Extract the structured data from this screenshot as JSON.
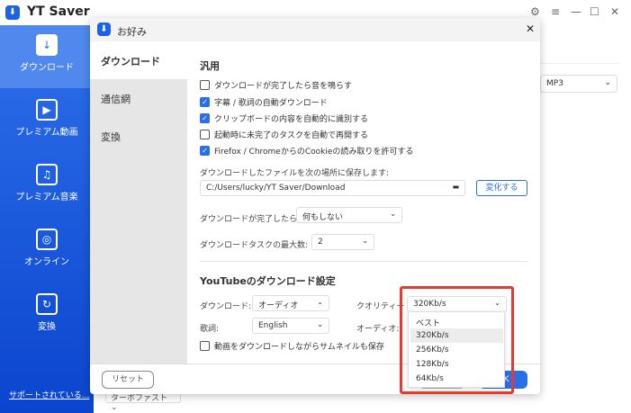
{
  "app": {
    "title": "YT Saver",
    "window_controls": [
      "gear-icon",
      "menu-icon",
      "minimize-icon",
      "maximize-icon",
      "close-icon"
    ]
  },
  "sidebar": {
    "items": [
      {
        "label": "ダウンロード",
        "icon": "download-icon"
      },
      {
        "label": "プレミアム動画",
        "icon": "play-icon"
      },
      {
        "label": "プレミアム音楽",
        "icon": "music-icon"
      },
      {
        "label": "オンライン",
        "icon": "globe-icon"
      },
      {
        "label": "変換",
        "icon": "convert-icon"
      }
    ],
    "support_link": "サポートされている..."
  },
  "background": {
    "format_select": "MP3",
    "speed_select": "ターボファスト"
  },
  "dialog": {
    "title": "お好み",
    "nav": [
      "ダウンロード",
      "通信網",
      "変換"
    ],
    "general": {
      "heading": "汎用",
      "checkboxes": [
        {
          "label": "ダウンロードが完了したら音を鳴らす",
          "checked": false
        },
        {
          "label": "字幕 / 歌詞の自動ダウンロード",
          "checked": true
        },
        {
          "label": "クリップボードの内容を自動的に識別する",
          "checked": true
        },
        {
          "label": "起動時に未完了のタスクを自動で再開する",
          "checked": false
        },
        {
          "label": "Firefox / ChromeからのCookieの読み取りを許可する",
          "checked": true
        }
      ],
      "save_label": "ダウンロードしたファイルを次の場所に保存します:",
      "save_path": "C:/Users/lucky/YT Saver/Download",
      "change_button": "変化する",
      "after_label": "ダウンロードが完了したら",
      "after_value": "何もしない",
      "max_label": "ダウンロードタスクの最大数:",
      "max_value": "2"
    },
    "youtube": {
      "heading": "YouTubeのダウンロード設定",
      "download_label": "ダウンロード:",
      "download_value": "オーディオ",
      "lyrics_label": "歌詞:",
      "lyrics_value": "English",
      "quality_label": "クオリティー",
      "quality_value": "320Kb/s",
      "audio_label": "オーディオ:",
      "thumb_label": "動画をダウンロードしながらサムネイルも保存",
      "thumb_checked": false,
      "quality_options": [
        "ベスト",
        "320Kb/s",
        "256Kb/s",
        "128Kb/s",
        "64Kb/s"
      ],
      "highlighted_option": "320Kb/s"
    },
    "reset_button": "リセット",
    "ok_button": "OK"
  },
  "colors": {
    "accent": "#1d62e6",
    "highlight_box": "#e8392f"
  }
}
